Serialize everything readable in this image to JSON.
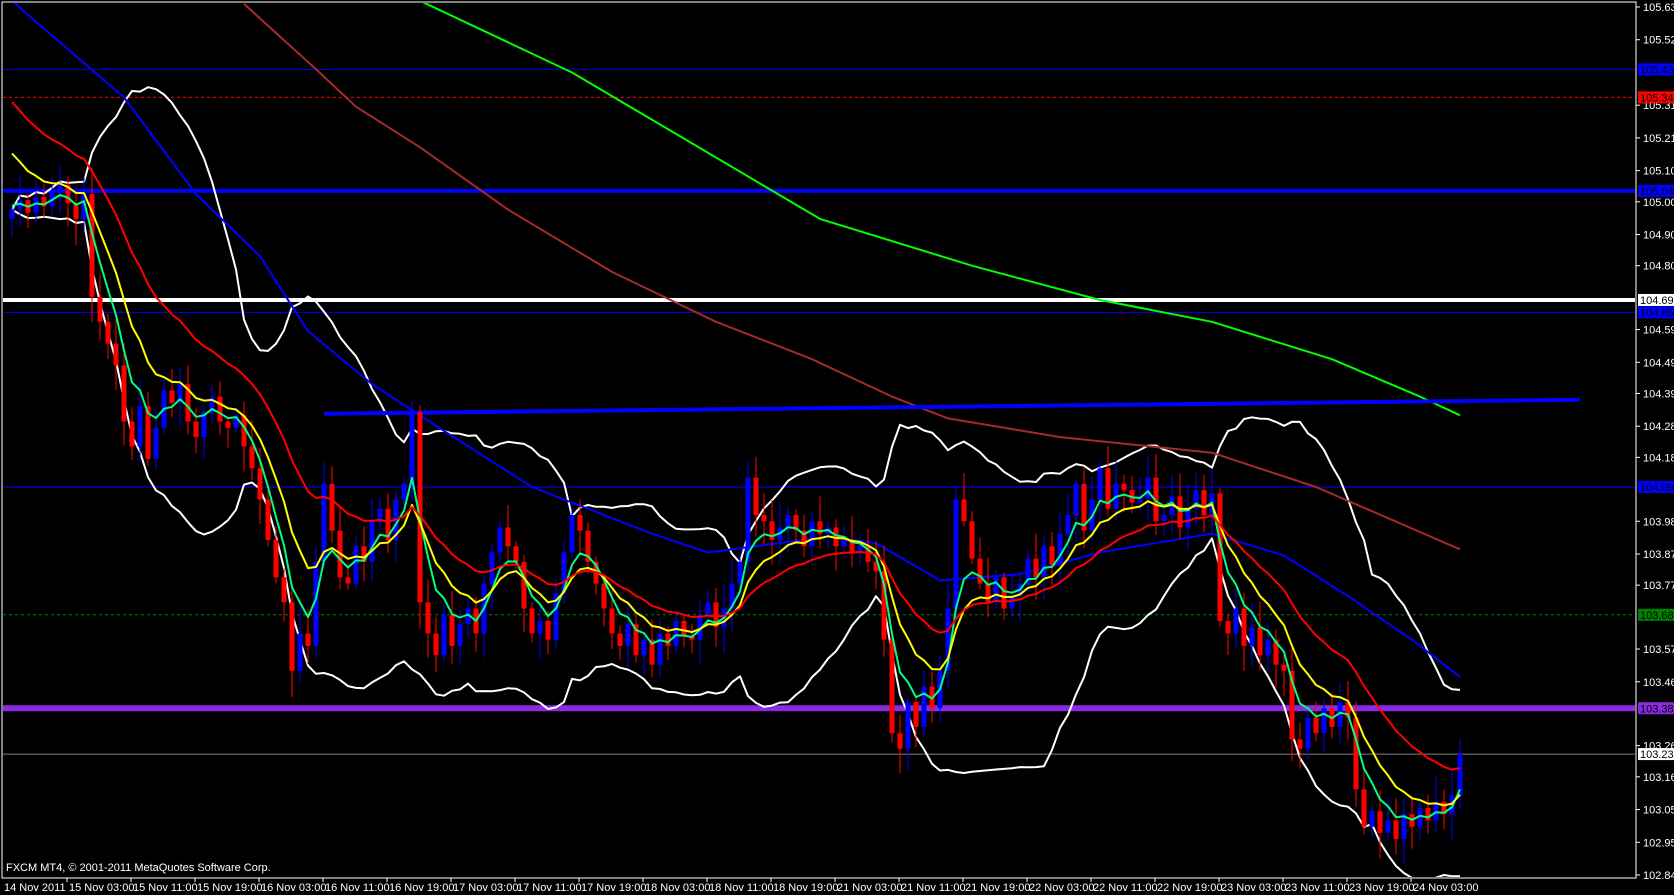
{
  "watermark": "FXCM MT4, © 2001-2011 MetaQuotes Software Corp.",
  "chart_data": {
    "type": "candlestick",
    "timeframe_hours": 1,
    "bull_color": "#0000ff",
    "bear_color": "#ff0000",
    "ylim": [
      102.845,
      105.63
    ],
    "y_tick_labels": [
      "105.630",
      "105.525",
      "105.315",
      "105.210",
      "105.105",
      "105.005",
      "104.900",
      "104.800",
      "104.595",
      "104.490",
      "104.390",
      "104.285",
      "104.185",
      "103.980",
      "103.875",
      "103.775",
      "103.570",
      "103.465",
      "103.260",
      "103.160",
      "103.055",
      "102.950",
      "102.845"
    ],
    "x_first_label": "14 Nov 2011",
    "x_tick_labels": [
      "15 Nov 03:00",
      "15 Nov 11:00",
      "15 Nov 19:00",
      "16 Nov 03:00",
      "16 Nov 11:00",
      "16 Nov 19:00",
      "17 Nov 03:00",
      "17 Nov 11:00",
      "17 Nov 19:00",
      "18 Nov 03:00",
      "18 Nov 11:00",
      "18 Nov 19:00",
      "21 Nov 03:00",
      "21 Nov 11:00",
      "21 Nov 19:00",
      "22 Nov 03:00",
      "22 Nov 11:00",
      "22 Nov 19:00",
      "23 Nov 03:00",
      "23 Nov 11:00",
      "23 Nov 19:00",
      "24 Nov 03:00"
    ],
    "closes": [
      104.98,
      105.01,
      104.97,
      105.02,
      104.99,
      105.04,
      105.06,
      105.0,
      104.95,
      105.03,
      104.7,
      104.62,
      104.55,
      104.48,
      104.3,
      104.22,
      104.35,
      104.18,
      104.28,
      104.4,
      104.36,
      104.42,
      104.3,
      104.25,
      104.33,
      104.38,
      104.3,
      104.28,
      104.32,
      104.22,
      104.15,
      104.05,
      103.92,
      103.8,
      103.72,
      103.5,
      103.62,
      103.58,
      103.85,
      104.1,
      103.95,
      103.8,
      103.78,
      103.9,
      103.85,
      103.98,
      104.02,
      103.92,
      104.05,
      104.1,
      104.33,
      103.72,
      103.62,
      103.55,
      103.68,
      103.58,
      103.65,
      103.7,
      103.62,
      103.78,
      103.88,
      103.96,
      103.9,
      103.85,
      103.7,
      103.62,
      103.66,
      103.6,
      103.75,
      103.88,
      104.0,
      103.95,
      103.85,
      103.78,
      103.7,
      103.62,
      103.58,
      103.65,
      103.55,
      103.6,
      103.52,
      103.62,
      103.58,
      103.66,
      103.61,
      103.6,
      103.68,
      103.72,
      103.64,
      103.7,
      103.78,
      103.85,
      104.12,
      104.0,
      103.98,
      103.92,
      103.96,
      104.0,
      103.95,
      103.9,
      103.98,
      103.94,
      103.96,
      103.9,
      103.92,
      103.88,
      103.9,
      103.85,
      103.82,
      103.6,
      103.3,
      103.25,
      103.4,
      103.32,
      103.45,
      103.38,
      103.5,
      103.7,
      104.05,
      103.98,
      103.86,
      103.78,
      103.72,
      103.8,
      103.7,
      103.74,
      103.78,
      103.86,
      103.8,
      103.9,
      103.84,
      103.94,
      104.0,
      104.1,
      103.95,
      104.05,
      104.15,
      104.02,
      104.1,
      104.08,
      104.04,
      104.05,
      104.12,
      103.98,
      104.0,
      104.06,
      103.96,
      104.02,
      104.08,
      104.0,
      104.07,
      103.66,
      103.62,
      103.7,
      103.58,
      103.64,
      103.55,
      103.6,
      103.52,
      103.5,
      103.28,
      103.25,
      103.35,
      103.3,
      103.38,
      103.32,
      103.4,
      103.35,
      103.12,
      103.0,
      103.05,
      102.98,
      103.02,
      102.96,
      103.04,
      103.0,
      103.06,
      103.02,
      103.08,
      103.04,
      103.1,
      103.233
    ],
    "computed_averages": [
      {
        "name": "ema-fast",
        "period": 5,
        "seed": 105.0,
        "color": "#00ff7f"
      },
      {
        "name": "ema-medium",
        "period": 10,
        "seed": 105.2,
        "color": "#ffff00"
      },
      {
        "name": "ema-slow",
        "period": 21,
        "seed": 105.36,
        "color": "#ff0000"
      }
    ],
    "bollinger": {
      "period": 20,
      "deviations": 2,
      "color": "#ffffff"
    },
    "long_averages": [
      {
        "name": "ma-blue",
        "color": "#0000ff",
        "points": [
          [
            0,
            105.65
          ],
          [
            4,
            105.56
          ],
          [
            14,
            105.34
          ],
          [
            23,
            105.03
          ],
          [
            31,
            104.83
          ],
          [
            37,
            104.59
          ],
          [
            45,
            104.42
          ],
          [
            54,
            104.27
          ],
          [
            65,
            104.09
          ],
          [
            80,
            103.94
          ],
          [
            87,
            103.88
          ],
          [
            102,
            103.93
          ],
          [
            108,
            103.91
          ],
          [
            116,
            103.79
          ],
          [
            126,
            103.81
          ],
          [
            136,
            103.88
          ],
          [
            150,
            103.94
          ],
          [
            159,
            103.87
          ],
          [
            167,
            103.74
          ],
          [
            175,
            103.6
          ],
          [
            181,
            103.48
          ]
        ]
      },
      {
        "name": "ma-brown",
        "color": "#a52a2a",
        "points": [
          [
            29,
            105.64
          ],
          [
            38,
            105.43
          ],
          [
            43,
            105.31
          ],
          [
            51,
            105.18
          ],
          [
            62,
            104.98
          ],
          [
            75,
            104.78
          ],
          [
            88,
            104.62
          ],
          [
            100,
            104.5
          ],
          [
            110,
            104.38
          ],
          [
            117,
            104.31
          ],
          [
            131,
            104.25
          ],
          [
            150,
            104.2
          ],
          [
            163,
            104.09
          ],
          [
            181,
            103.89
          ]
        ]
      },
      {
        "name": "ma-green",
        "color": "#00ff00",
        "points": [
          [
            51,
            105.65
          ],
          [
            70,
            105.42
          ],
          [
            101,
            104.95
          ],
          [
            120,
            104.8
          ],
          [
            136,
            104.69
          ],
          [
            150,
            104.62
          ],
          [
            165,
            104.5
          ],
          [
            176,
            104.38
          ],
          [
            181,
            104.32
          ]
        ]
      }
    ],
    "trendline": {
      "color": "#0000ff",
      "points": [
        [
          39,
          104.325
        ],
        [
          196,
          104.37
        ]
      ]
    },
    "levels": [
      {
        "price": 105.43,
        "label": "105.430",
        "color": "#0000ff",
        "text_color": "#000000",
        "kind": "thin"
      },
      {
        "price": 105.34,
        "label": "105.340",
        "color": "#ff0000",
        "text_color": "#000000",
        "kind": "dashed"
      },
      {
        "price": 105.04,
        "label": "105.040",
        "color": "#0000ff",
        "text_color": "#000000",
        "kind": "thick"
      },
      {
        "price": 104.69,
        "label": "104.690",
        "color": "#ffffff",
        "text_color": "#000000",
        "kind": "thick"
      },
      {
        "price": 104.65,
        "label": "104.650",
        "color": "#0000ff",
        "text_color": "#000000",
        "kind": "thin"
      },
      {
        "price": 104.09,
        "label": "104.090",
        "color": "#0000ff",
        "text_color": "#000000",
        "kind": "thin"
      },
      {
        "price": 103.68,
        "label": "103.680",
        "color": "#008000",
        "text_color": "#000000",
        "kind": "dashed"
      },
      {
        "price": 103.38,
        "label": "103.380",
        "color": "#8a2be2",
        "text_color": "#000000",
        "kind": "heavy"
      },
      {
        "price": 103.233,
        "label": "103.233",
        "color": "#808080",
        "tag_color": "#ffffff",
        "text_color": "#000000",
        "kind": "bid"
      }
    ]
  }
}
